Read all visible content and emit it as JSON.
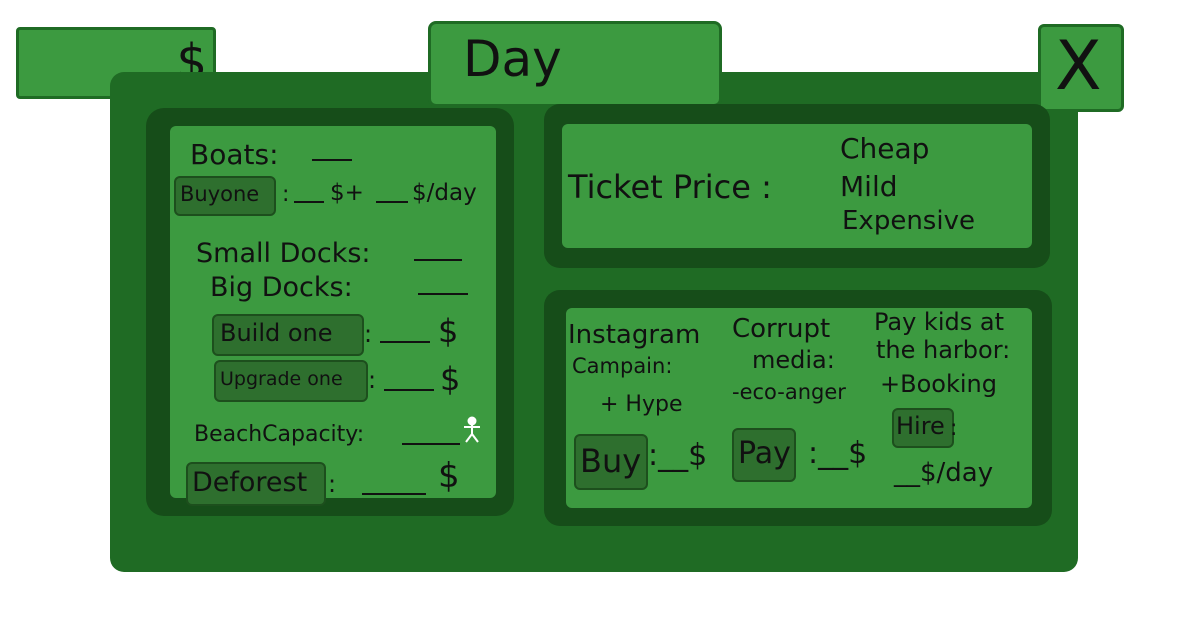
{
  "colors": {
    "frame": "#1f6b24",
    "frame_dark": "#164d19",
    "panel": "#3c9a40",
    "button": "#2e6f2e"
  },
  "top": {
    "money_icon": "$",
    "day_title": "Day",
    "close_icon": "X"
  },
  "left": {
    "boats_label": "Boats:",
    "buy_one_button": "Buyone",
    "boat_cost_dollar": "$+",
    "boat_cost_per_day": "$/day",
    "small_docks_label": "Small Docks:",
    "big_docks_label": "Big Docks:",
    "build_one_button": "Build one",
    "build_colon": ":",
    "build_dollar": "$",
    "upgrade_one_button": "Upgrade one",
    "upgrade_colon": ":",
    "upgrade_dollar": "$",
    "beach_capacity_label": "BeachCapacity:",
    "deforest_button": "Deforest",
    "deforest_colon": ":",
    "deforest_dollar": "$"
  },
  "ticket": {
    "label": "Ticket Price :",
    "options": [
      "Cheap",
      "Mild",
      "Expensive"
    ]
  },
  "marketing": {
    "instagram_title_1": "Instagram",
    "instagram_title_2": "Campain:",
    "instagram_effect": "+ Hype",
    "corrupt_title_1": "Corrupt",
    "corrupt_title_2": "media:",
    "corrupt_effect": "-eco-anger",
    "kids_title_1": "Pay kids at",
    "kids_title_2": "the harbor:",
    "kids_effect": "+Booking",
    "buy_button": "Buy",
    "buy_dollar": ":__$",
    "pay_button": "Pay",
    "pay_dollar": ":__$",
    "hire_button": "Hire",
    "hire_colon": ":",
    "hire_cost": "__$/day"
  }
}
